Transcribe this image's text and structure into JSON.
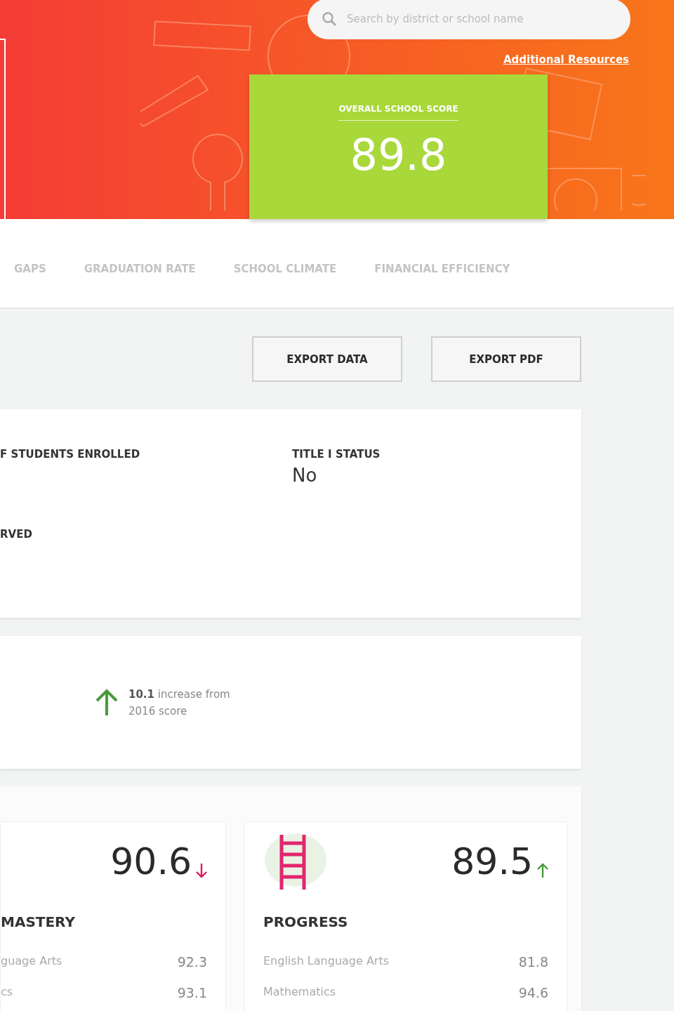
{
  "header": {
    "search": {
      "placeholder": "Search by district or school name"
    },
    "link": "Additional Resources",
    "overall_score": {
      "label": "OVERALL SCHOOL SCORE",
      "value": "89.8"
    }
  },
  "tabs": [
    {
      "label": "GAPS",
      "selected": false
    },
    {
      "label": "GRADUATION RATE",
      "selected": false
    },
    {
      "label": "SCHOOL CLIMATE",
      "selected": false
    },
    {
      "label": "FINANCIAL EFFICIENCY",
      "selected": false
    }
  ],
  "actions": [
    "EXPORT DATA",
    "EXPORT PDF"
  ],
  "info": {
    "fields": [
      {
        "label": "F STUDENTS ENROLLED"
      },
      {
        "label": "TITLE I STATUS",
        "value": "No"
      },
      {
        "label": "RVED"
      }
    ]
  },
  "trend": {
    "increase": true,
    "text": "**10.1** increase from 2016 score"
  },
  "metrics": [
    {
      "title": "MASTERY",
      "score": "90.6",
      "increase": false,
      "rows": [
        {
          "label": "guage Arts",
          "value": "92.3"
        },
        {
          "label": "cs",
          "value": "93.1"
        }
      ]
    },
    {
      "title": "PROGRESS",
      "score": "89.5",
      "increase": true,
      "rows": [
        {
          "label": "English Language Arts",
          "value": "81.8"
        },
        {
          "label": "Mathematics",
          "value": "94.6"
        }
      ]
    }
  ]
}
